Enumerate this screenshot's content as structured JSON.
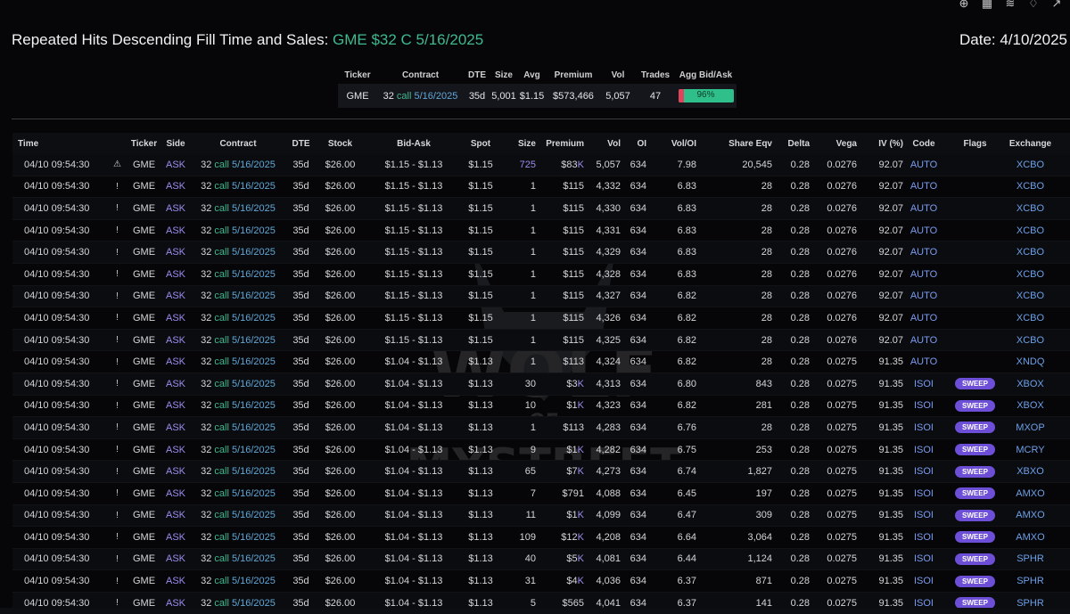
{
  "header": {
    "title_prefix": "Repeated Hits Descending Fill Time and Sales: ",
    "title_highlight": "GME $32 C 5/16/2025",
    "date": "Date: 4/10/2025"
  },
  "summary": {
    "headers": [
      "Ticker",
      "Contract",
      "DTE",
      "Size",
      "Avg",
      "Premium",
      "Vol",
      "Trades",
      "Agg Bid/Ask"
    ],
    "row": {
      "ticker": "GME",
      "strike": "32",
      "type": "call",
      "expiry": "5/16/2025",
      "dte": "35d",
      "size": "5,001",
      "avg": "$1.15",
      "premium": "$573,466",
      "vol": "5,057",
      "trades": "47",
      "agg_pct_label": "96%",
      "agg_fraction_ask": 0.96
    }
  },
  "table": {
    "headers": [
      "Time",
      "",
      "Ticker",
      "Side",
      "Contract",
      "DTE",
      "Stock",
      "Bid-Ask",
      "Spot",
      "Size",
      "Premium",
      "Vol",
      "OI",
      "Vol/OI",
      "Share Eqv",
      "Delta",
      "Vega",
      "IV (%)",
      "Code",
      "Flags",
      "Exchange"
    ],
    "rows": [
      {
        "time": "04/10 09:54:30",
        "icon": "⚠",
        "ticker": "GME",
        "side": "ASK",
        "strike": "32",
        "type": "call",
        "expiry": "5/16/2025",
        "dte": "35d",
        "stock": "$26.00",
        "bidask": "$1.15 - $1.13",
        "spot": "$1.15",
        "size": "725",
        "premium": "$83K",
        "vol": "5,057",
        "oi": "634",
        "voloi": "7.98",
        "share": "20,545",
        "delta": "0.28",
        "vega": "0.0276",
        "iv": "92.07",
        "code": "AUTO",
        "flag": "",
        "exch": "XCBO"
      },
      {
        "time": "04/10 09:54:30",
        "icon": "!",
        "ticker": "GME",
        "side": "ASK",
        "strike": "32",
        "type": "call",
        "expiry": "5/16/2025",
        "dte": "35d",
        "stock": "$26.00",
        "bidask": "$1.15 - $1.13",
        "spot": "$1.15",
        "size": "1",
        "premium": "$115",
        "vol": "4,332",
        "oi": "634",
        "voloi": "6.83",
        "share": "28",
        "delta": "0.28",
        "vega": "0.0276",
        "iv": "92.07",
        "code": "AUTO",
        "flag": "",
        "exch": "XCBO"
      },
      {
        "time": "04/10 09:54:30",
        "icon": "!",
        "ticker": "GME",
        "side": "ASK",
        "strike": "32",
        "type": "call",
        "expiry": "5/16/2025",
        "dte": "35d",
        "stock": "$26.00",
        "bidask": "$1.15 - $1.13",
        "spot": "$1.15",
        "size": "1",
        "premium": "$115",
        "vol": "4,330",
        "oi": "634",
        "voloi": "6.83",
        "share": "28",
        "delta": "0.28",
        "vega": "0.0276",
        "iv": "92.07",
        "code": "AUTO",
        "flag": "",
        "exch": "XCBO"
      },
      {
        "time": "04/10 09:54:30",
        "icon": "!",
        "ticker": "GME",
        "side": "ASK",
        "strike": "32",
        "type": "call",
        "expiry": "5/16/2025",
        "dte": "35d",
        "stock": "$26.00",
        "bidask": "$1.15 - $1.13",
        "spot": "$1.15",
        "size": "1",
        "premium": "$115",
        "vol": "4,331",
        "oi": "634",
        "voloi": "6.83",
        "share": "28",
        "delta": "0.28",
        "vega": "0.0276",
        "iv": "92.07",
        "code": "AUTO",
        "flag": "",
        "exch": "XCBO"
      },
      {
        "time": "04/10 09:54:30",
        "icon": "!",
        "ticker": "GME",
        "side": "ASK",
        "strike": "32",
        "type": "call",
        "expiry": "5/16/2025",
        "dte": "35d",
        "stock": "$26.00",
        "bidask": "$1.15 - $1.13",
        "spot": "$1.15",
        "size": "1",
        "premium": "$115",
        "vol": "4,329",
        "oi": "634",
        "voloi": "6.83",
        "share": "28",
        "delta": "0.28",
        "vega": "0.0276",
        "iv": "92.07",
        "code": "AUTO",
        "flag": "",
        "exch": "XCBO"
      },
      {
        "time": "04/10 09:54:30",
        "icon": "!",
        "ticker": "GME",
        "side": "ASK",
        "strike": "32",
        "type": "call",
        "expiry": "5/16/2025",
        "dte": "35d",
        "stock": "$26.00",
        "bidask": "$1.15 - $1.13",
        "spot": "$1.15",
        "size": "1",
        "premium": "$115",
        "vol": "4,328",
        "oi": "634",
        "voloi": "6.83",
        "share": "28",
        "delta": "0.28",
        "vega": "0.0276",
        "iv": "92.07",
        "code": "AUTO",
        "flag": "",
        "exch": "XCBO"
      },
      {
        "time": "04/10 09:54:30",
        "icon": "!",
        "ticker": "GME",
        "side": "ASK",
        "strike": "32",
        "type": "call",
        "expiry": "5/16/2025",
        "dte": "35d",
        "stock": "$26.00",
        "bidask": "$1.15 - $1.13",
        "spot": "$1.15",
        "size": "1",
        "premium": "$115",
        "vol": "4,327",
        "oi": "634",
        "voloi": "6.82",
        "share": "28",
        "delta": "0.28",
        "vega": "0.0276",
        "iv": "92.07",
        "code": "AUTO",
        "flag": "",
        "exch": "XCBO"
      },
      {
        "time": "04/10 09:54:30",
        "icon": "!",
        "ticker": "GME",
        "side": "ASK",
        "strike": "32",
        "type": "call",
        "expiry": "5/16/2025",
        "dte": "35d",
        "stock": "$26.00",
        "bidask": "$1.15 - $1.13",
        "spot": "$1.15",
        "size": "1",
        "premium": "$115",
        "vol": "4,326",
        "oi": "634",
        "voloi": "6.82",
        "share": "28",
        "delta": "0.28",
        "vega": "0.0276",
        "iv": "92.07",
        "code": "AUTO",
        "flag": "",
        "exch": "XCBO"
      },
      {
        "time": "04/10 09:54:30",
        "icon": "!",
        "ticker": "GME",
        "side": "ASK",
        "strike": "32",
        "type": "call",
        "expiry": "5/16/2025",
        "dte": "35d",
        "stock": "$26.00",
        "bidask": "$1.15 - $1.13",
        "spot": "$1.15",
        "size": "1",
        "premium": "$115",
        "vol": "4,325",
        "oi": "634",
        "voloi": "6.82",
        "share": "28",
        "delta": "0.28",
        "vega": "0.0276",
        "iv": "92.07",
        "code": "AUTO",
        "flag": "",
        "exch": "XCBO"
      },
      {
        "time": "04/10 09:54:30",
        "icon": "!",
        "ticker": "GME",
        "side": "ASK",
        "strike": "32",
        "type": "call",
        "expiry": "5/16/2025",
        "dte": "35d",
        "stock": "$26.00",
        "bidask": "$1.04 - $1.13",
        "spot": "$1.13",
        "size": "1",
        "premium": "$113",
        "vol": "4,324",
        "oi": "634",
        "voloi": "6.82",
        "share": "28",
        "delta": "0.28",
        "vega": "0.0275",
        "iv": "91.35",
        "code": "AUTO",
        "flag": "",
        "exch": "XNDQ"
      },
      {
        "time": "04/10 09:54:30",
        "icon": "!",
        "ticker": "GME",
        "side": "ASK",
        "strike": "32",
        "type": "call",
        "expiry": "5/16/2025",
        "dte": "35d",
        "stock": "$26.00",
        "bidask": "$1.04 - $1.13",
        "spot": "$1.13",
        "size": "30",
        "premium": "$3K",
        "vol": "4,313",
        "oi": "634",
        "voloi": "6.80",
        "share": "843",
        "delta": "0.28",
        "vega": "0.0275",
        "iv": "91.35",
        "code": "ISOI",
        "flag": "SWEEP",
        "exch": "XBOX"
      },
      {
        "time": "04/10 09:54:30",
        "icon": "!",
        "ticker": "GME",
        "side": "ASK",
        "strike": "32",
        "type": "call",
        "expiry": "5/16/2025",
        "dte": "35d",
        "stock": "$26.00",
        "bidask": "$1.04 - $1.13",
        "spot": "$1.13",
        "size": "10",
        "premium": "$1K",
        "vol": "4,323",
        "oi": "634",
        "voloi": "6.82",
        "share": "281",
        "delta": "0.28",
        "vega": "0.0275",
        "iv": "91.35",
        "code": "ISOI",
        "flag": "SWEEP",
        "exch": "XBOX"
      },
      {
        "time": "04/10 09:54:30",
        "icon": "!",
        "ticker": "GME",
        "side": "ASK",
        "strike": "32",
        "type": "call",
        "expiry": "5/16/2025",
        "dte": "35d",
        "stock": "$26.00",
        "bidask": "$1.04 - $1.13",
        "spot": "$1.13",
        "size": "1",
        "premium": "$113",
        "vol": "4,283",
        "oi": "634",
        "voloi": "6.76",
        "share": "28",
        "delta": "0.28",
        "vega": "0.0275",
        "iv": "91.35",
        "code": "ISOI",
        "flag": "SWEEP",
        "exch": "MXOP"
      },
      {
        "time": "04/10 09:54:30",
        "icon": "!",
        "ticker": "GME",
        "side": "ASK",
        "strike": "32",
        "type": "call",
        "expiry": "5/16/2025",
        "dte": "35d",
        "stock": "$26.00",
        "bidask": "$1.04 - $1.13",
        "spot": "$1.13",
        "size": "9",
        "premium": "$1K",
        "vol": "4,282",
        "oi": "634",
        "voloi": "6.75",
        "share": "253",
        "delta": "0.28",
        "vega": "0.0275",
        "iv": "91.35",
        "code": "ISOI",
        "flag": "SWEEP",
        "exch": "MCRY"
      },
      {
        "time": "04/10 09:54:30",
        "icon": "!",
        "ticker": "GME",
        "side": "ASK",
        "strike": "32",
        "type": "call",
        "expiry": "5/16/2025",
        "dte": "35d",
        "stock": "$26.00",
        "bidask": "$1.04 - $1.13",
        "spot": "$1.13",
        "size": "65",
        "premium": "$7K",
        "vol": "4,273",
        "oi": "634",
        "voloi": "6.74",
        "share": "1,827",
        "delta": "0.28",
        "vega": "0.0275",
        "iv": "91.35",
        "code": "ISOI",
        "flag": "SWEEP",
        "exch": "XBXO"
      },
      {
        "time": "04/10 09:54:30",
        "icon": "!",
        "ticker": "GME",
        "side": "ASK",
        "strike": "32",
        "type": "call",
        "expiry": "5/16/2025",
        "dte": "35d",
        "stock": "$26.00",
        "bidask": "$1.04 - $1.13",
        "spot": "$1.13",
        "size": "7",
        "premium": "$791",
        "vol": "4,088",
        "oi": "634",
        "voloi": "6.45",
        "share": "197",
        "delta": "0.28",
        "vega": "0.0275",
        "iv": "91.35",
        "code": "ISOI",
        "flag": "SWEEP",
        "exch": "AMXO"
      },
      {
        "time": "04/10 09:54:30",
        "icon": "!",
        "ticker": "GME",
        "side": "ASK",
        "strike": "32",
        "type": "call",
        "expiry": "5/16/2025",
        "dte": "35d",
        "stock": "$26.00",
        "bidask": "$1.04 - $1.13",
        "spot": "$1.13",
        "size": "11",
        "premium": "$1K",
        "vol": "4,099",
        "oi": "634",
        "voloi": "6.47",
        "share": "309",
        "delta": "0.28",
        "vega": "0.0275",
        "iv": "91.35",
        "code": "ISOI",
        "flag": "SWEEP",
        "exch": "AMXO"
      },
      {
        "time": "04/10 09:54:30",
        "icon": "!",
        "ticker": "GME",
        "side": "ASK",
        "strike": "32",
        "type": "call",
        "expiry": "5/16/2025",
        "dte": "35d",
        "stock": "$26.00",
        "bidask": "$1.04 - $1.13",
        "spot": "$1.13",
        "size": "109",
        "premium": "$12K",
        "vol": "4,208",
        "oi": "634",
        "voloi": "6.64",
        "share": "3,064",
        "delta": "0.28",
        "vega": "0.0275",
        "iv": "91.35",
        "code": "ISOI",
        "flag": "SWEEP",
        "exch": "AMXO"
      },
      {
        "time": "04/10 09:54:30",
        "icon": "!",
        "ticker": "GME",
        "side": "ASK",
        "strike": "32",
        "type": "call",
        "expiry": "5/16/2025",
        "dte": "35d",
        "stock": "$26.00",
        "bidask": "$1.04 - $1.13",
        "spot": "$1.13",
        "size": "40",
        "premium": "$5K",
        "vol": "4,081",
        "oi": "634",
        "voloi": "6.44",
        "share": "1,124",
        "delta": "0.28",
        "vega": "0.0275",
        "iv": "91.35",
        "code": "ISOI",
        "flag": "SWEEP",
        "exch": "SPHR"
      },
      {
        "time": "04/10 09:54:30",
        "icon": "!",
        "ticker": "GME",
        "side": "ASK",
        "strike": "32",
        "type": "call",
        "expiry": "5/16/2025",
        "dte": "35d",
        "stock": "$26.00",
        "bidask": "$1.04 - $1.13",
        "spot": "$1.13",
        "size": "31",
        "premium": "$4K",
        "vol": "4,036",
        "oi": "634",
        "voloi": "6.37",
        "share": "871",
        "delta": "0.28",
        "vega": "0.0275",
        "iv": "91.35",
        "code": "ISOI",
        "flag": "SWEEP",
        "exch": "SPHR"
      },
      {
        "time": "04/10 09:54:30",
        "icon": "!",
        "ticker": "GME",
        "side": "ASK",
        "strike": "32",
        "type": "call",
        "expiry": "5/16/2025",
        "dte": "35d",
        "stock": "$26.00",
        "bidask": "$1.04 - $1.13",
        "spot": "$1.13",
        "size": "5",
        "premium": "$565",
        "vol": "4,041",
        "oi": "634",
        "voloi": "6.37",
        "share": "141",
        "delta": "0.28",
        "vega": "0.0275",
        "iv": "91.35",
        "code": "ISOI",
        "flag": "SWEEP",
        "exch": "SPHR"
      }
    ]
  },
  "watermark": {
    "line1": "WOLF",
    "line2": "OF",
    "line3": "MYSTREET"
  },
  "icons": [
    "plus-circle-icon",
    "calculator-icon",
    "layers-icon",
    "bell-icon",
    "chart-line-icon"
  ],
  "colors": {
    "call": "#3fb98e",
    "ask": "#9d8cf0",
    "sweep_bg": "#6c4fd6",
    "code": "#7a9cf0",
    "exchange": "#6ca0e8",
    "agg_ask": "#2ebf8b",
    "agg_bid": "#e0445c"
  }
}
